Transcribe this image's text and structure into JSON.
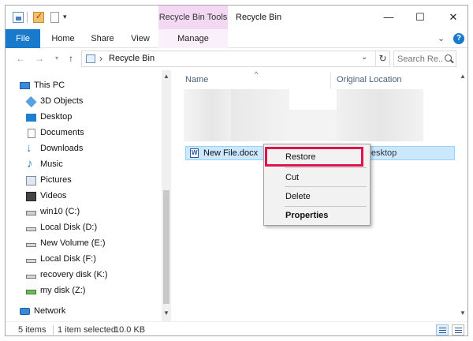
{
  "titlebar": {
    "tool_tab_title": "Recycle Bin Tools",
    "window_title": "Recycle Bin",
    "minimize": "—",
    "maximize": "☐",
    "close": "✕",
    "qa_dropdown": "▾"
  },
  "ribbon": {
    "tabs": [
      {
        "label": "File"
      },
      {
        "label": "Home"
      },
      {
        "label": "Share"
      },
      {
        "label": "View"
      },
      {
        "label": "Manage"
      }
    ],
    "expand": "⌄",
    "help": "?"
  },
  "addressbar": {
    "back": "←",
    "forward": "→",
    "recent": "▾",
    "up": "↑",
    "separator": "›",
    "path": "Recycle Bin",
    "dropdown": "⌄",
    "refresh": "↻"
  },
  "search": {
    "placeholder": "Search Re..."
  },
  "navpane": {
    "items": [
      {
        "label": "This PC",
        "icon": "computer-icon"
      },
      {
        "label": "3D Objects",
        "icon": "3d-objects-icon"
      },
      {
        "label": "Desktop",
        "icon": "desktop-icon"
      },
      {
        "label": "Documents",
        "icon": "documents-icon"
      },
      {
        "label": "Downloads",
        "icon": "downloads-icon"
      },
      {
        "label": "Music",
        "icon": "music-icon"
      },
      {
        "label": "Pictures",
        "icon": "pictures-icon"
      },
      {
        "label": "Videos",
        "icon": "videos-icon"
      },
      {
        "label": "win10 (C:)",
        "icon": "windows-drive-icon"
      },
      {
        "label": "Local Disk (D:)",
        "icon": "drive-icon"
      },
      {
        "label": "New Volume (E:)",
        "icon": "drive-icon"
      },
      {
        "label": "Local Disk (F:)",
        "icon": "drive-icon"
      },
      {
        "label": "recovery disk (K:)",
        "icon": "drive-icon"
      },
      {
        "label": "my disk (Z:)",
        "icon": "removable-drive-icon"
      },
      {
        "label": "Network",
        "icon": "network-icon"
      }
    ]
  },
  "content": {
    "sort_indicator": "^",
    "columns": {
      "name": "Name",
      "original_location": "Original Location"
    },
    "file": {
      "name": "New File.docx",
      "location": "wner\\Desktop"
    }
  },
  "context_menu": {
    "restore": "Restore",
    "cut": "Cut",
    "delete": "Delete",
    "properties": "Properties"
  },
  "statusbar": {
    "item_count": "5 items",
    "selection": "1 item selected",
    "size": "10.0 KB"
  },
  "scroll": {
    "up": "▲",
    "down": "▼"
  },
  "colors": {
    "file_tab": "#1979ca",
    "tool_tab": "#f2d8f2",
    "selection": "#cce8ff",
    "highlight_box": "#e0144c"
  }
}
